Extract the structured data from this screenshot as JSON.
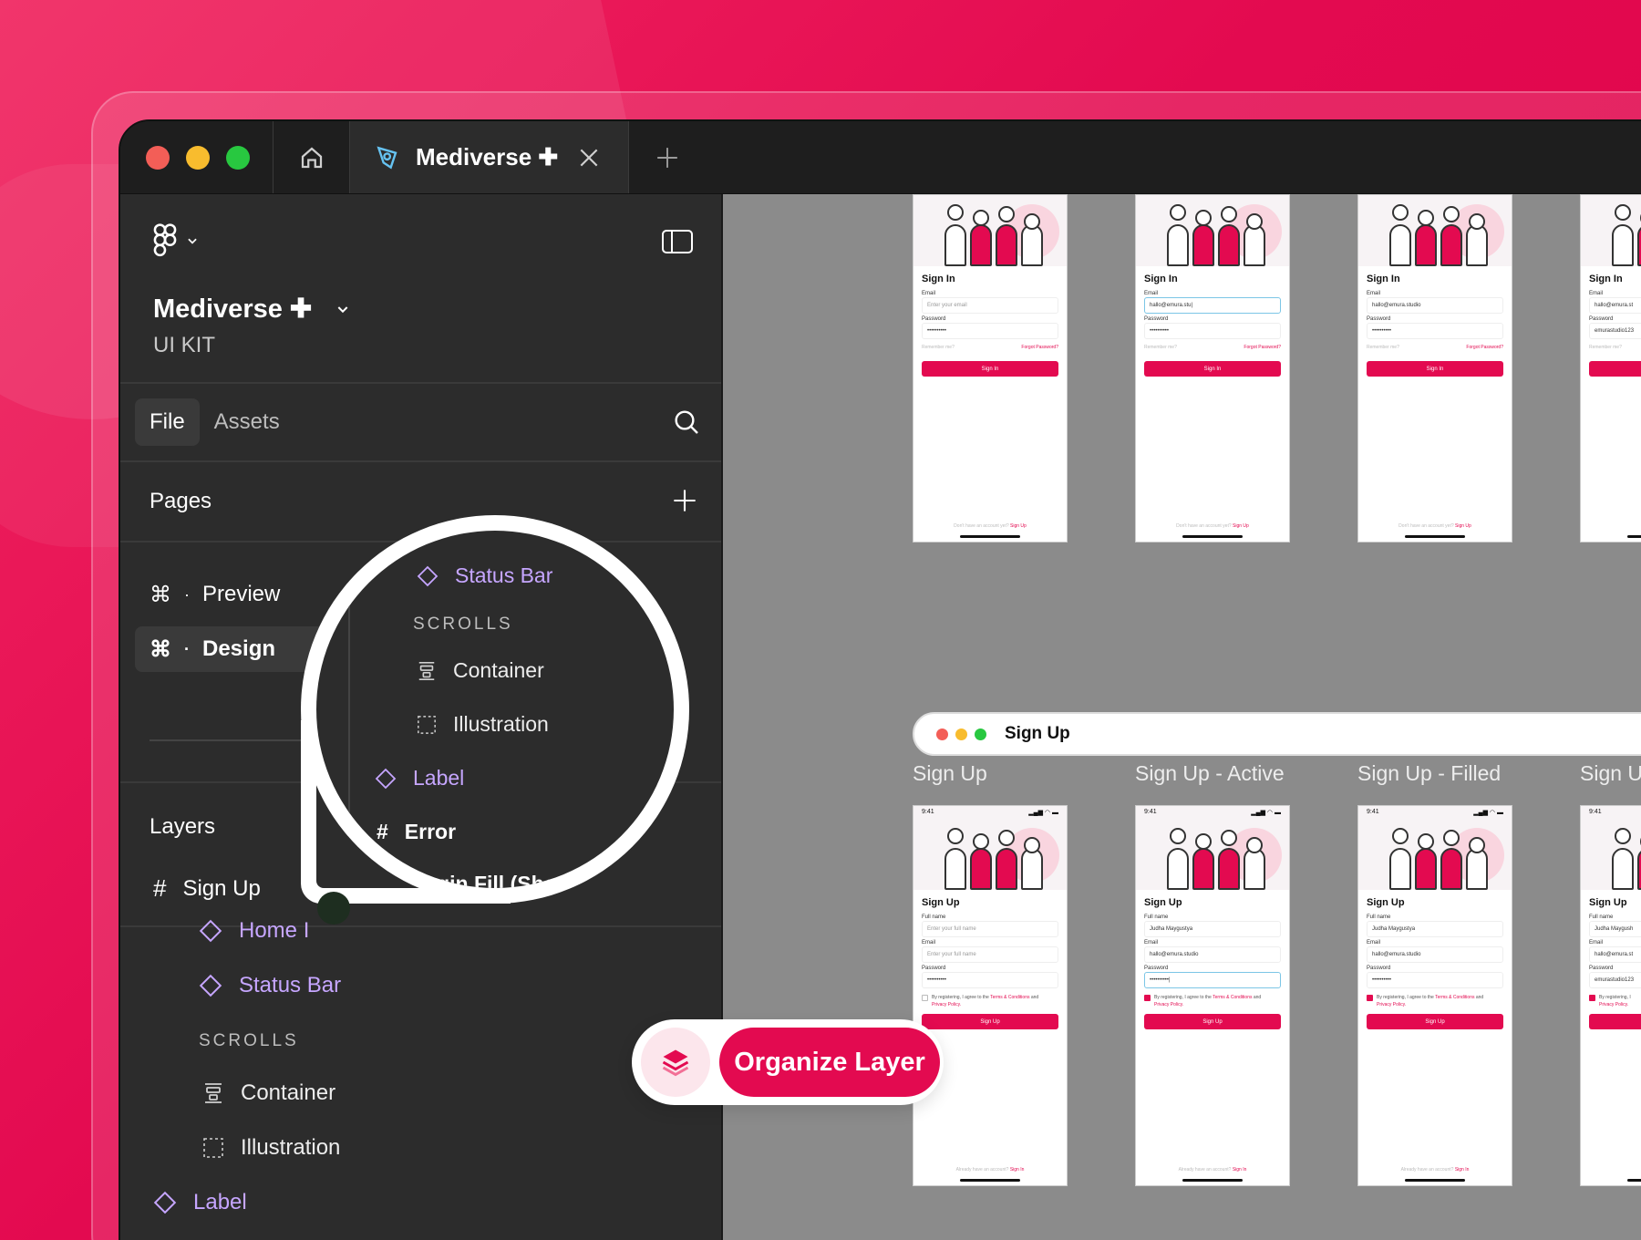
{
  "brand": {
    "accent": "#E30A50",
    "component_purple": "#C6A6FF",
    "sidebar_bg": "#2C2C2C",
    "canvas_bg": "#8B8B8B"
  },
  "titlebar": {
    "traffic_lights": [
      "#F35E57",
      "#F8BC2E",
      "#28C840"
    ],
    "home_icon": "home-icon",
    "tab_title": "Mediverse ✚",
    "tab_icon": "figma-file-icon",
    "close_icon": "close-icon",
    "new_tab_icon": "plus-icon"
  },
  "sidebar": {
    "menu_icon": "figma-logo-icon",
    "project_name": "Mediverse ✚",
    "project_sub": "UI KIT",
    "tabs": {
      "file": "File",
      "assets": "Assets"
    },
    "pages": {
      "title": "Pages",
      "items": [
        {
          "shortcut": "⌘",
          "label": "Preview"
        },
        {
          "shortcut": "⌘",
          "label": "Design"
        }
      ]
    },
    "layers": {
      "title": "Layers",
      "frame": "Sign Up",
      "items": [
        {
          "label": "Home I",
          "type": "component"
        },
        {
          "label": "Status Bar",
          "type": "component"
        },
        {
          "label": "SCROLLS",
          "type": "section"
        },
        {
          "label": "Container",
          "type": "layout"
        },
        {
          "label": "Illustration",
          "type": "placeholder"
        },
        {
          "label": "Label",
          "type": "component"
        }
      ]
    }
  },
  "magnifier": {
    "items": [
      {
        "label": "Status Bar",
        "type": "component"
      },
      {
        "label": "SCROLLS",
        "type": "section"
      },
      {
        "label": "Container",
        "type": "layout"
      },
      {
        "label": "Illustration",
        "type": "placeholder"
      },
      {
        "label": "Label",
        "type": "component"
      },
      {
        "label": "Error",
        "type": "frame"
      },
      {
        "label": "Login Fill (Show",
        "type": "frame"
      }
    ]
  },
  "canvas": {
    "signin_phones": [
      {
        "title": "Sign In",
        "email_label": "Email",
        "email": "Enter your email",
        "password_label": "Password",
        "password": "••••••••••",
        "remember": "Remember me?",
        "forgot": "Forgot Password?",
        "button": "Sign In",
        "footer": "Don't have an account yet?",
        "footer_link": "Sign Up",
        "state": "empty"
      },
      {
        "title": "Sign In",
        "email_label": "Email",
        "email": "hallo@emura.stu|",
        "password_label": "Password",
        "password": "••••••••••",
        "remember": "Remember me?",
        "forgot": "Forgot Password?",
        "button": "Sign In",
        "footer": "Don't have an account yet?",
        "footer_link": "Sign Up",
        "state": "active"
      },
      {
        "title": "Sign In",
        "email_label": "Email",
        "email": "hallo@emura.studio",
        "password_label": "Password",
        "password": "••••••••••",
        "remember": "Remember me?",
        "forgot": "Forgot Password?",
        "button": "Sign In",
        "footer": "Don't have an account yet?",
        "footer_link": "Sign Up",
        "state": "filled"
      },
      {
        "title": "Sign In",
        "email_label": "Email",
        "email": "hallo@emura.st",
        "password_label": "Password",
        "password": "emurastudio123",
        "remember": "Remember me?",
        "forgot": "",
        "button": "",
        "footer": "",
        "footer_link": "",
        "state": "filled"
      }
    ],
    "signup_bar_title": "Sign Up",
    "frame_labels": [
      "Sign Up",
      "Sign Up - Active",
      "Sign Up - Filled",
      "Sign U"
    ],
    "signup_phones": [
      {
        "time": "9:41",
        "title": "Sign Up",
        "name_label": "Full name",
        "name": "Enter your full name",
        "email_label": "Email",
        "email": "Enter your full name",
        "password_label": "Password",
        "password": "••••••••••",
        "terms_a": "By registering, I agree to the",
        "terms_link": "Terms & Conditions",
        "terms_b": "and",
        "privacy": "Privacy Policy.",
        "button": "Sign Up",
        "footer": "Already have an account?",
        "footer_link": "Sign In",
        "state": "empty"
      },
      {
        "time": "9:41",
        "title": "Sign Up",
        "name_label": "Full name",
        "name": "Judha Maygustya",
        "email_label": "Email",
        "email": "hallo@emura.studio",
        "password_label": "Password",
        "password": "••••••••••|",
        "terms_a": "By registering, I agree to the",
        "terms_link": "Terms & Conditions",
        "terms_b": "and",
        "privacy": "Privacy Policy.",
        "button": "Sign Up",
        "footer": "Already have an account?",
        "footer_link": "Sign In",
        "state": "active"
      },
      {
        "time": "9:41",
        "title": "Sign Up",
        "name_label": "Full name",
        "name": "Judha Maygustya",
        "email_label": "Email",
        "email": "hallo@emura.studio",
        "password_label": "Password",
        "password": "••••••••••",
        "terms_a": "By registering, I agree to the",
        "terms_link": "Terms & Conditions",
        "terms_b": "and",
        "privacy": "Privacy Policy.",
        "button": "Sign Up",
        "footer": "Already have an account?",
        "footer_link": "Sign In",
        "state": "filled"
      },
      {
        "time": "9:41",
        "title": "Sign Up",
        "name_label": "Full name",
        "name": "Judha Maygush",
        "email_label": "Email",
        "email": "hallo@emura.st",
        "password_label": "Password",
        "password": "emurastudio123",
        "terms_a": "By registering, I",
        "terms_link": "",
        "terms_b": "",
        "privacy": "Privacy Policy.",
        "button": "",
        "footer": "",
        "footer_link": "",
        "state": "filled"
      }
    ]
  },
  "organize": {
    "label": "Organize Layer",
    "icon": "layers-stack-icon"
  }
}
